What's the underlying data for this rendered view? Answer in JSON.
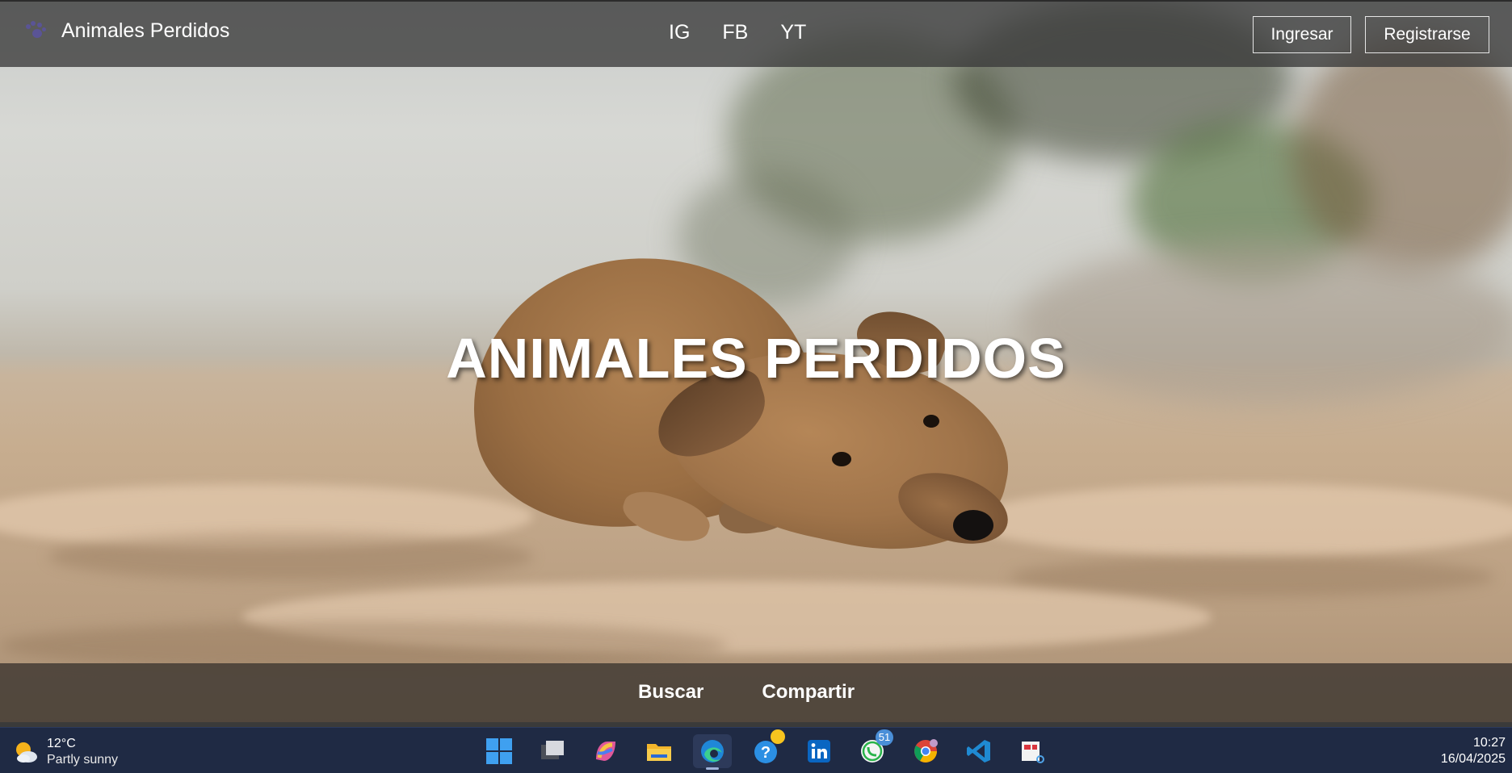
{
  "navbar": {
    "brand_icon": "paw-icon",
    "brand_title": "Animales Perdidos",
    "links": [
      "IG",
      "FB",
      "YT"
    ],
    "login_label": "Ingresar",
    "register_label": "Registrarse"
  },
  "hero": {
    "title": "ANIMALES PERDIDOS",
    "image": "dog-on-beach-photo"
  },
  "actions": {
    "search_label": "Buscar",
    "share_label": "Compartir"
  },
  "taskbar": {
    "weather": {
      "temp": "12°C",
      "condition": "Partly sunny",
      "icon": "partly-sunny-icon"
    },
    "apps": [
      {
        "name": "windows-start-icon"
      },
      {
        "name": "task-view-icon"
      },
      {
        "name": "copilot-icon"
      },
      {
        "name": "file-explorer-icon"
      },
      {
        "name": "edge-icon",
        "active": true
      },
      {
        "name": "help-icon"
      },
      {
        "name": "linkedin-icon"
      },
      {
        "name": "whatsapp-icon",
        "badge": "51"
      },
      {
        "name": "chrome-icon"
      },
      {
        "name": "vscode-icon"
      },
      {
        "name": "snipping-tool-icon"
      }
    ],
    "time": "10:27",
    "date": "16/04/2025"
  },
  "colors": {
    "navbar_bg": "#3a3a3a",
    "action_bar_bg": "#463e36",
    "taskbar_bg": "#1f2a44",
    "brand_accent": "#5a5496"
  }
}
